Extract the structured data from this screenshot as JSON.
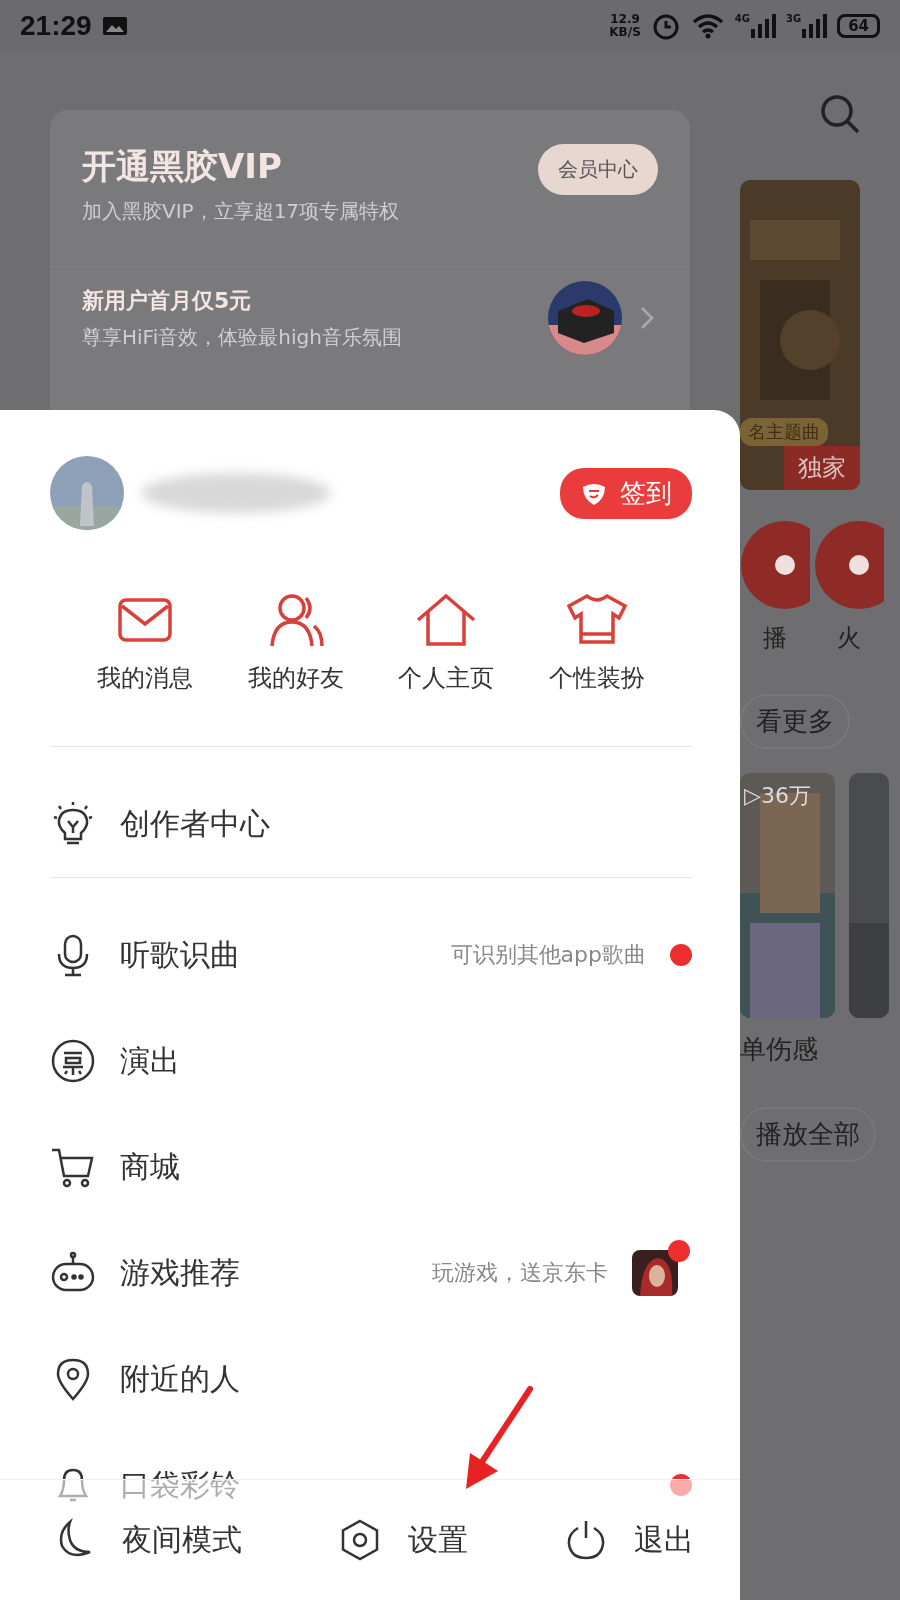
{
  "status_bar": {
    "time": "21:29",
    "net_speed": "12.9",
    "net_unit": "KB/S",
    "net_4g": "4G",
    "net_3g": "3G",
    "battery": "64"
  },
  "vip_card": {
    "title": "开通黑胶VIP",
    "subtitle": "加入黑胶VIP，立享超17项专属特权",
    "button": "会员中心",
    "promo_title": "新用户首月仅5元",
    "promo_text": "尊享HiFi音效，体验最high音乐氛围"
  },
  "background": {
    "cover_caption": "名主题曲",
    "badge": "独家",
    "shortcuts": [
      "播",
      "火"
    ],
    "more": "看更多",
    "play_count": "▷36万",
    "playlist_title": "单伤感",
    "play_all": "播放全部"
  },
  "profile": {
    "checkin": "签到"
  },
  "quick_links": [
    {
      "label": "我的消息",
      "kind": "mail"
    },
    {
      "label": "我的好友",
      "kind": "friends"
    },
    {
      "label": "个人主页",
      "kind": "home"
    },
    {
      "label": "个性装扮",
      "kind": "shirt"
    }
  ],
  "menu_sections": [
    [
      {
        "label": "创作者中心",
        "kind": "bulb",
        "dot": false
      }
    ],
    [
      {
        "label": "听歌识曲",
        "kind": "mic",
        "hint": "可识别其他app歌曲",
        "dot": true
      },
      {
        "label": "演出",
        "kind": "ticket",
        "dot": false
      },
      {
        "label": "商城",
        "kind": "cart",
        "dot": false
      },
      {
        "label": "游戏推荐",
        "kind": "gamepad",
        "hint": "玩游戏，送京东卡",
        "thumbnail": true,
        "dot": true
      },
      {
        "label": "附近的人",
        "kind": "pin",
        "dot": false
      },
      {
        "label": "口袋彩铃",
        "kind": "bell",
        "dot": true
      }
    ]
  ],
  "bottom_bar": [
    {
      "label": "夜间模式",
      "kind": "moon"
    },
    {
      "label": "设置",
      "kind": "hexagon"
    },
    {
      "label": "退出",
      "kind": "power"
    }
  ]
}
